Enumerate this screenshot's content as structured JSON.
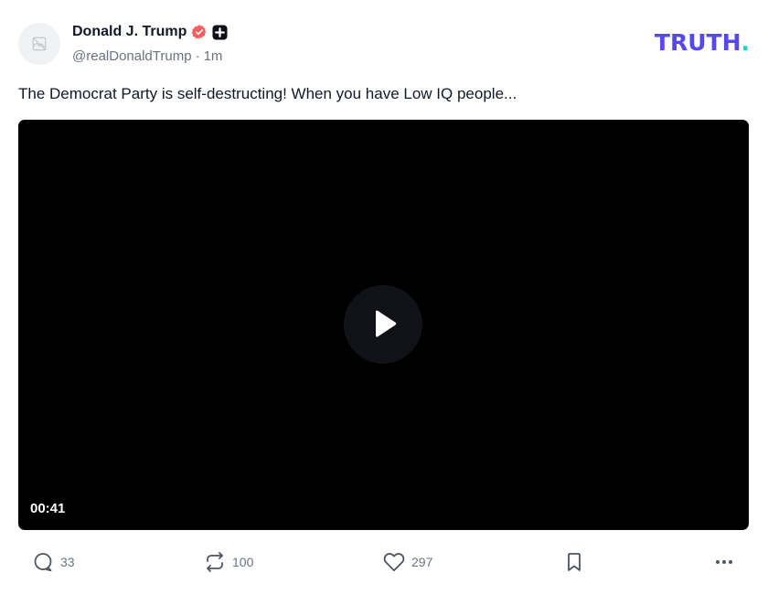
{
  "post": {
    "author": {
      "display_name": "Donald J. Trump",
      "handle": "@realDonaldTrump",
      "verified_icon": "verified-badge-icon",
      "plus_icon": "plus-badge-icon"
    },
    "separator": "·",
    "timestamp": "1m",
    "text": "The Democrat Party is self-destructing! When you have Low IQ people...",
    "video": {
      "duration": "00:41",
      "play_icon": "play-icon"
    },
    "actions": {
      "reply_count": "33",
      "retruth_count": "100",
      "like_count": "297"
    }
  },
  "brand": {
    "logo_main": "TRUTH",
    "logo_dot": ".",
    "colors": {
      "primary": "#5448ee",
      "accent": "#14d7c6",
      "verified": "#ff5d5d"
    }
  }
}
